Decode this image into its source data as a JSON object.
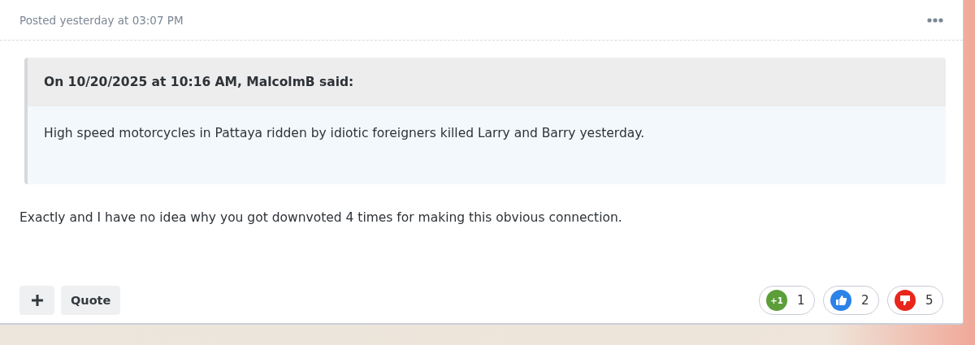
{
  "post": {
    "timestamp": "Posted yesterday at 03:07 PM",
    "quote": {
      "citation": "On 10/20/2025 at 10:16 AM, MalcolmB said:",
      "text": "High speed motorcycles in Pattaya ridden by idiotic foreigners killed Larry and Barry yesterday."
    },
    "body": "Exactly and I have no idea why you got downvoted 4 times for making this obvious connection.",
    "quote_button": "Quote",
    "reactions": [
      {
        "kind": "plus_one",
        "badge": "+1",
        "count": "1"
      },
      {
        "kind": "like",
        "count": "2"
      },
      {
        "kind": "dislike",
        "count": "5"
      }
    ]
  }
}
